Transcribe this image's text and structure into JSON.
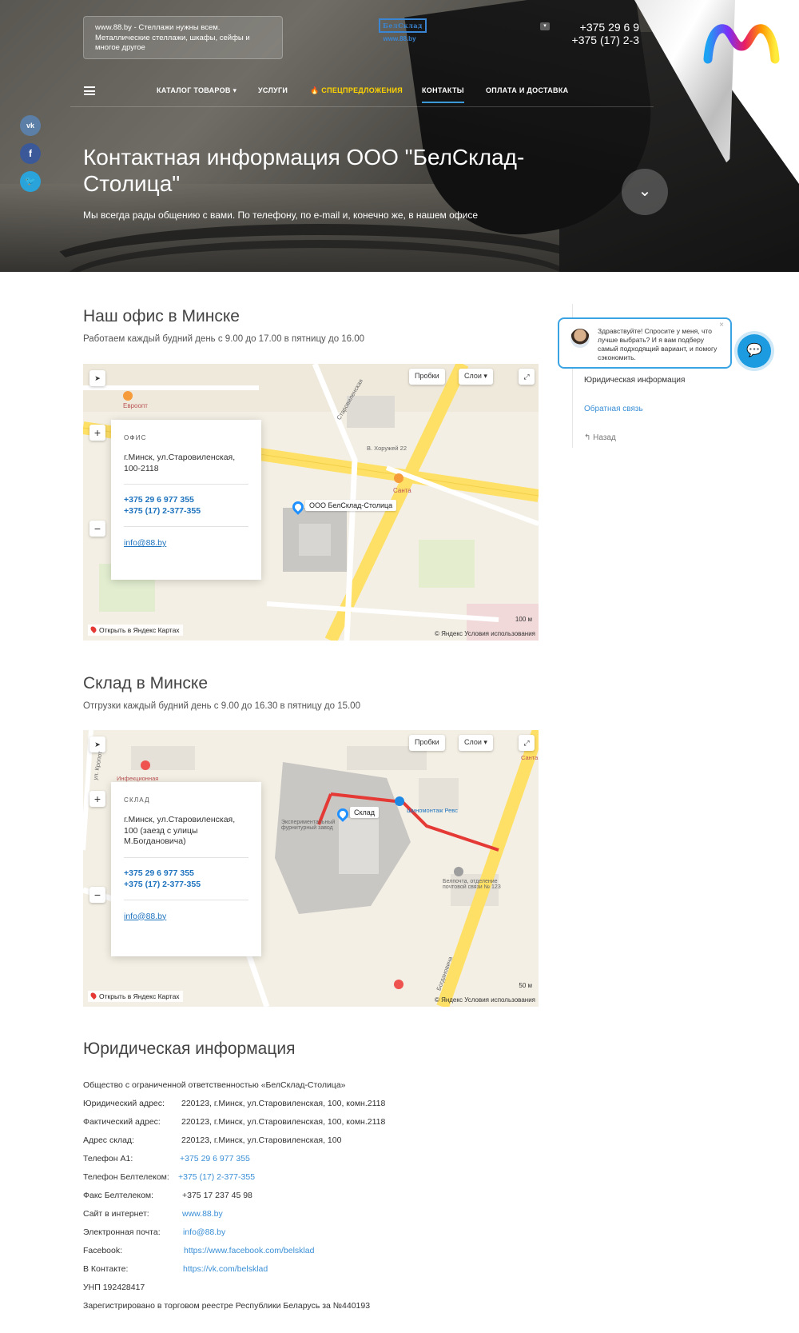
{
  "header": {
    "info_text": "www.88.by - Стеллажи нужны всем. Металлические стеллажи, шкафы, сейфы и многое другое",
    "logo_mark": "БелСклад",
    "logo_sub": "www.88.by",
    "phone_1": "+375 29 6 9",
    "phone_2": "+375 (17) 2-3",
    "phone_dropdown": "▾"
  },
  "nav": {
    "items": [
      {
        "label": "КАТАЛОГ ТОВАРОВ ▾"
      },
      {
        "label": "УСЛУГИ"
      },
      {
        "label": "🔥 СПЕЦПРЕДЛОЖЕНИЯ"
      },
      {
        "label": "КОНТАКТЫ"
      },
      {
        "label": "ОПЛАТА И ДОСТАВКА"
      }
    ]
  },
  "social": [
    {
      "label": "vk",
      "color": "#5b7fa6"
    },
    {
      "label": "f",
      "color": "#3b5998"
    },
    {
      "label": "🐦",
      "color": "#2aa3db"
    }
  ],
  "hero": {
    "title": "Контактная информация ООО \"БелСклад-Столица\"",
    "subtitle": "Мы всегда рады общению с вами. По телефону, по e-mail и, конечно же, в нашем офисе",
    "scroll_icon": "⌄"
  },
  "office": {
    "title": "Наш офис в Минске",
    "hours": "Работаем каждый будний день с 9.00 до 17.00 в пятницу до 16.00",
    "card_label": "офис",
    "address": "г.Минск, ул.Старовиленская, 100-2118",
    "phone_1": "+375 29 6 977 355",
    "phone_2": "+375 (17) 2-377-355",
    "email": "info@88.by",
    "pin_label": "ООО БелСклад-Столица",
    "scale": "100 м",
    "labels": [
      "Евроопт",
      "Санта",
      "В. Хоружей 22",
      "Старовиленская"
    ]
  },
  "warehouse": {
    "title": "Склад в Минске",
    "hours": "Отгрузки каждый будний день с 9.00 до 16.30 в пятницу до 15.00",
    "card_label": "склад",
    "address": "г.Минск, ул.Старовиленская, 100 (заезд с улицы М.Богдановича)",
    "phone_1": "+375 29 6 977 355",
    "phone_2": "+375 (17) 2-377-355",
    "email": "info@88.by",
    "pin_label": "Склад",
    "scale": "50 м",
    "labels": [
      "Шиномонтаж Ревс",
      "Белпочта, отделение почтовой связи № 123",
      "Экспериментальный фурнитурный завод",
      "Инфекционная",
      "Санта",
      "ул. Кропот",
      "Богдановича"
    ]
  },
  "map_controls": {
    "traffic": "Пробки",
    "layers": "Слои ▾",
    "zoom_in": "+",
    "zoom_out": "−",
    "open_yandex": "Открыть в Яндекс Картах",
    "copyright": "© Яндекс Условия использования"
  },
  "sidebar": {
    "legal": "Юридическая информация",
    "feedback": "Обратная связь",
    "back": "↰ Назад"
  },
  "chat": {
    "text": "Здравствуйте! Спросите у меня, что лучше выбрать? И я вам подберу самый подходящий вариант, и помогу сэкономить.",
    "close": "×",
    "button_icon": "💬"
  },
  "legal": {
    "title": "Юридическая информация",
    "rows": [
      {
        "k": "Общество с ограниченной ответственностью «БелСклад-Столица»",
        "v": ""
      },
      {
        "k": "Юридический адрес:",
        "v": "220123, г.Минск, ул.Старовиленская, 100, комн.2118"
      },
      {
        "k": "Фактический адрес:",
        "v": "220123, г.Минск, ул.Старовиленская, 100, комн.2118"
      },
      {
        "k": "Адрес склад:",
        "v": "220123, г.Минск, ул.Старовиленская, 100"
      },
      {
        "k": "Телефон A1:",
        "v": "+375 29 6 977 355"
      },
      {
        "k": "Телефон Белтелеком:",
        "v": "+375 (17) 2-377-355"
      },
      {
        "k": "Факс Белтелеком:",
        "v": "+375 17 237 45 98"
      },
      {
        "k": "Сайт в интернет:",
        "v": "www.88.by"
      },
      {
        "k": "Электронная почта:",
        "v": "info@88.by"
      },
      {
        "k": "Facebook:",
        "v": "https://www.facebook.com/belsklad"
      },
      {
        "k": "В Контакте:",
        "v": "https://vk.com/belsklad"
      },
      {
        "k": "УНП 192428417",
        "v": ""
      },
      {
        "k": "Зарегистрировано в торговом реестре Республики Беларусь за №440193",
        "v": ""
      }
    ]
  }
}
